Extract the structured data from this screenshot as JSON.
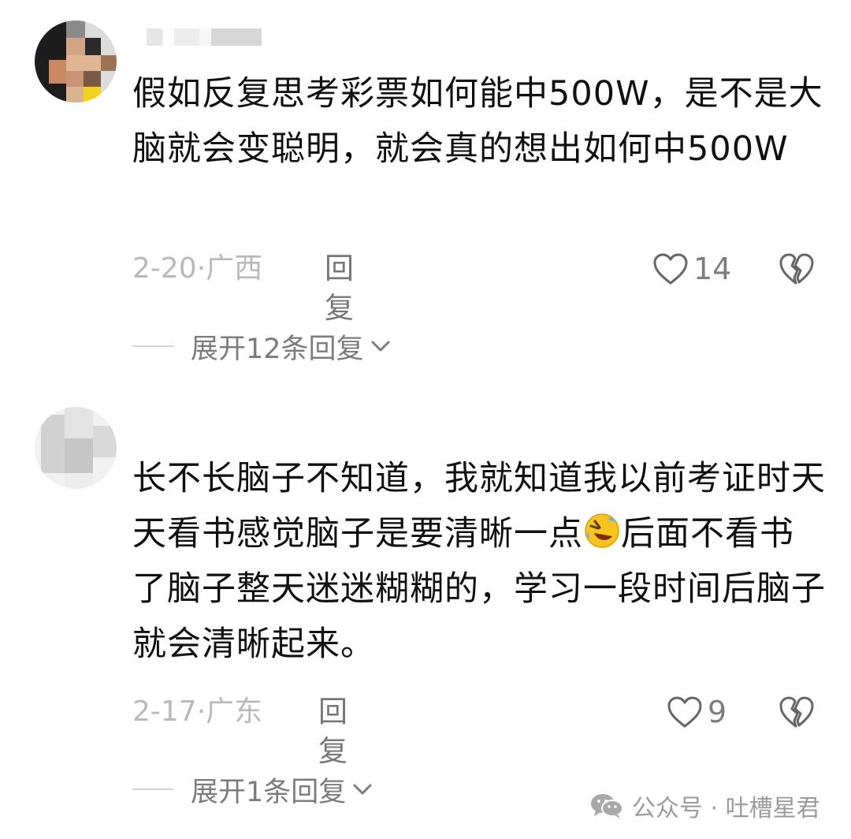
{
  "comments": [
    {
      "text": "假如反复思考彩票如何能中500W，是不是大脑就会变聪明，就会真的想出如何中500W",
      "date": "2-20",
      "region": "广西",
      "reply_label": "回复",
      "likes": "14",
      "expand_label": "展开12条回复"
    },
    {
      "text_before_emoji": "长不长脑子不知道，我就知道我以前考证时天天看书感觉脑子是要清晰一点",
      "emoji": "rolling-on-floor-laughing-emoji",
      "text_after_emoji": "后面不看书了脑子整天迷迷糊糊的，学习一段时间后脑子就会清晰起来。",
      "date": "2-17",
      "region": "广东",
      "reply_label": "回复",
      "likes": "9",
      "expand_label": "展开1条回复"
    }
  ],
  "meta_separator": "·",
  "watermark": "公众号 · 吐槽星君",
  "icons": {
    "like": "heart-outline-icon",
    "dislike": "broken-heart-icon",
    "expand": "chevron-down-icon",
    "watermark": "wechat-icon"
  },
  "colors": {
    "text": "#111111",
    "meta": "#b9b9b9",
    "reply": "#777777",
    "icon": "#666666"
  }
}
